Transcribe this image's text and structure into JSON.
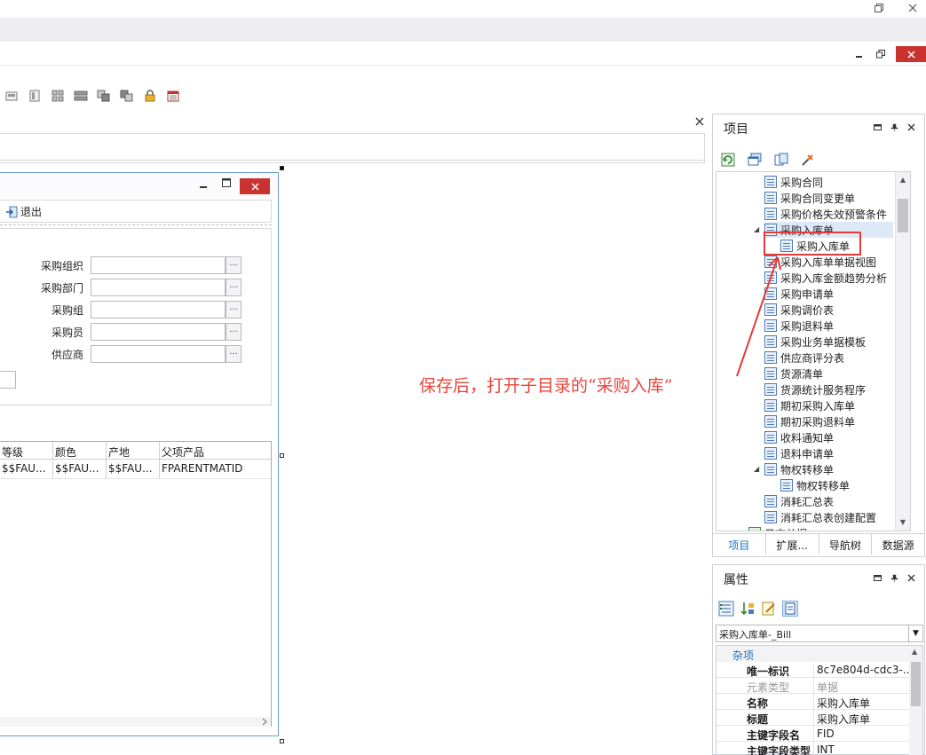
{
  "form": {
    "exit_label": "退出",
    "fields": [
      {
        "label": "采购组织"
      },
      {
        "label": "采购部门"
      },
      {
        "label": "采购组"
      },
      {
        "label": "采购员"
      },
      {
        "label": "供应商"
      }
    ],
    "ellipsis": "···",
    "grid": {
      "headers": [
        "等级",
        "颜色",
        "产地",
        "父项产品"
      ],
      "row": [
        "$$FAU...",
        "$$FAU...",
        "$$FAU...",
        "FPARENTMATID"
      ]
    }
  },
  "project_panel": {
    "title": "项目",
    "tree": [
      {
        "label": "采购合同",
        "indent": 1
      },
      {
        "label": "采购合同变更单",
        "indent": 1
      },
      {
        "label": "采购价格失效预警条件",
        "indent": 1
      },
      {
        "label": "采购入库单",
        "indent": 1,
        "expanded": true,
        "selected": true
      },
      {
        "label": "采购入库单",
        "indent": 2,
        "highlighted": true
      },
      {
        "label": "采购入库单单据视图",
        "indent": 1
      },
      {
        "label": "采购入库金额趋势分析",
        "indent": 1
      },
      {
        "label": "采购申请单",
        "indent": 1
      },
      {
        "label": "采购调价表",
        "indent": 1
      },
      {
        "label": "采购退料单",
        "indent": 1
      },
      {
        "label": "采购业务单据模板",
        "indent": 1
      },
      {
        "label": "供应商评分表",
        "indent": 1
      },
      {
        "label": "货源清单",
        "indent": 1
      },
      {
        "label": "货源统计服务程序",
        "indent": 1
      },
      {
        "label": "期初采购入库单",
        "indent": 1
      },
      {
        "label": "期初采购退料单",
        "indent": 1
      },
      {
        "label": "收料通知单",
        "indent": 1
      },
      {
        "label": "退料申请单",
        "indent": 1
      },
      {
        "label": "物权转移单",
        "indent": 1,
        "expanded": true
      },
      {
        "label": "物权转移单",
        "indent": 2
      },
      {
        "label": "消耗汇总表",
        "indent": 1
      },
      {
        "label": "消耗汇总表创建配置",
        "indent": 1
      },
      {
        "label": "日志单据",
        "indent": 0
      }
    ],
    "tabs": [
      "项目",
      "扩展...",
      "导航树",
      "数据源"
    ]
  },
  "properties_panel": {
    "title": "属性",
    "selected_object": "采购入库单-_Bill",
    "category": "杂项",
    "rows": [
      {
        "name": "唯一标识",
        "value": "8c7e804d-cdc3-...",
        "disabled": false
      },
      {
        "name": "元素类型",
        "value": "单据",
        "disabled": true
      },
      {
        "name": "名称",
        "value": "采购入库单",
        "disabled": false
      },
      {
        "name": "标题",
        "value": "采购入库单",
        "disabled": false
      },
      {
        "name": "主键字段名",
        "value": "FID",
        "disabled": false
      },
      {
        "name": "主键字段类型",
        "value": "INT",
        "disabled": false
      }
    ]
  },
  "annotation": {
    "text": "保存后，打开子目录的“采购入库”",
    "color": "#e8453c"
  },
  "colors": {
    "accent": "#1e6fb5",
    "close_red": "#c8332f",
    "form_border": "#6a9bd3"
  }
}
